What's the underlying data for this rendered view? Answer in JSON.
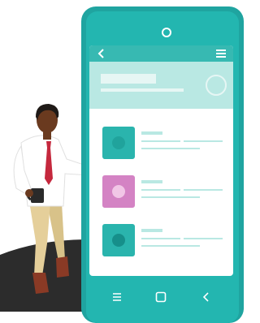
{
  "colors": {
    "phone_body": "#1fa4a0",
    "phone_face": "#23b6b0",
    "app_bar": "#37b9b2",
    "hero_bg": "#b9e8e3",
    "skin": "#6a3a1f",
    "hair": "#1f1a17",
    "shirt": "#ffffff",
    "tie": "#c5283d",
    "pants": "#e5cf9a",
    "shoes": "#8a3a25",
    "mug": "#2a2a2a",
    "floor": "#2c2c2c"
  },
  "screen": {
    "icons": {
      "back": "chevron-left-icon",
      "menu": "hamburger-menu-icon",
      "profile": "circle-placeholder-icon"
    },
    "list": [
      {
        "thumb": "#2ab4ad",
        "dot": "#20a39c",
        "text": "#b9e8e3"
      },
      {
        "thumb": "#d483c4",
        "dot": "#f1c6e6",
        "text": "#b9e8e3"
      },
      {
        "thumb": "#2ab4ad",
        "dot": "#168f8a",
        "text": "#b9e8e3"
      }
    ]
  },
  "nav": {
    "icons": [
      "menu-lines-icon",
      "home-square-icon",
      "back-chevron-icon"
    ]
  }
}
